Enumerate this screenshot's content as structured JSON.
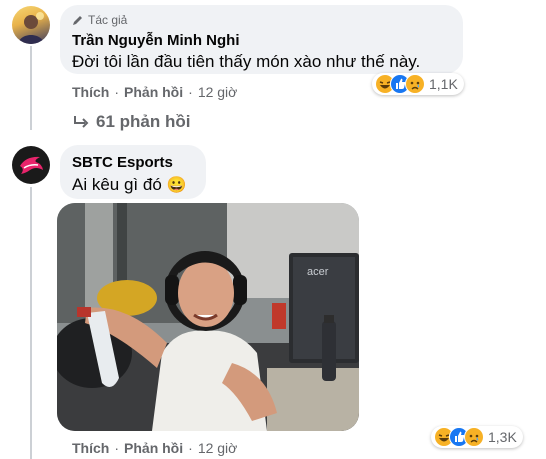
{
  "comment1": {
    "badge": "Tác giả",
    "author": "Trần Nguyễn Minh Nghi",
    "text": "Đời tôi lần đầu tiên thấy món xào như thế này.",
    "like_label": "Thích",
    "reply_label": "Phản hồi",
    "time": "12 giờ",
    "reaction_count": "1,1K",
    "reactions": [
      "haha-icon",
      "like-icon",
      "sad-icon"
    ],
    "replies_link": "61 phản hồi"
  },
  "comment2": {
    "author": "SBTC Esports",
    "text": "Ai kêu gì đó",
    "emoji": "😀",
    "like_label": "Thích",
    "reply_label": "Phản hồi",
    "time": "12 giờ",
    "reaction_count": "1,3K",
    "reactions": [
      "haha-icon",
      "like-icon",
      "sad-icon"
    ],
    "photo_brand": "acer"
  },
  "separator": "·",
  "colors": {
    "bubble": "#f0f2f5",
    "meta": "#65676b",
    "like_blue": "#1877f2",
    "haha_yellow": "#f7b125"
  }
}
